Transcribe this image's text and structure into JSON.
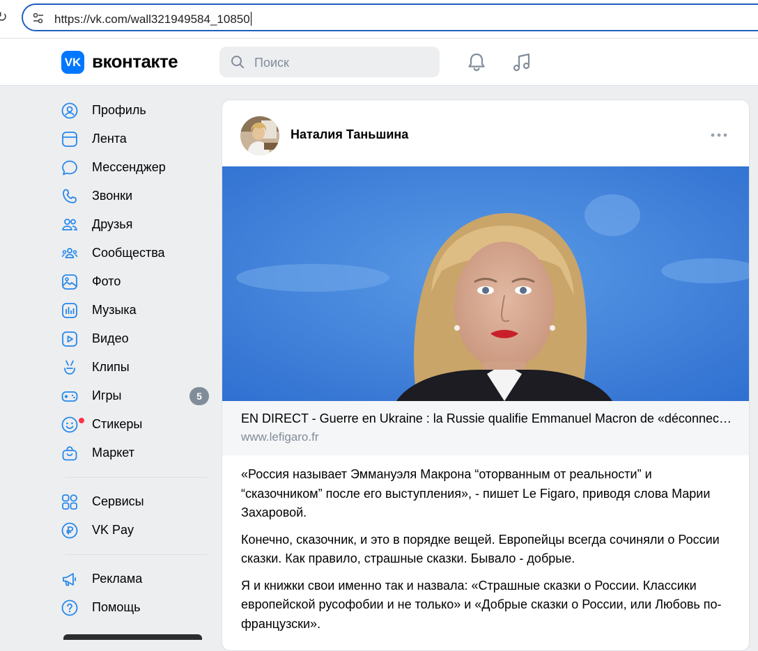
{
  "browser": {
    "url": "https://vk.com/wall321949584_10850"
  },
  "header": {
    "logo_mark": "VK",
    "logo_text": "вконтакте",
    "search_placeholder": "Поиск",
    "icons": [
      "bell-icon",
      "music-note-icon"
    ]
  },
  "sidebar": {
    "items": [
      {
        "label": "Профиль",
        "icon": "profile-icon"
      },
      {
        "label": "Лента",
        "icon": "feed-icon"
      },
      {
        "label": "Мессенджер",
        "icon": "messenger-icon"
      },
      {
        "label": "Звонки",
        "icon": "phone-icon"
      },
      {
        "label": "Друзья",
        "icon": "friends-icon"
      },
      {
        "label": "Сообщества",
        "icon": "communities-icon"
      },
      {
        "label": "Фото",
        "icon": "photo-icon"
      },
      {
        "label": "Музыка",
        "icon": "music-icon"
      },
      {
        "label": "Видео",
        "icon": "video-icon"
      },
      {
        "label": "Клипы",
        "icon": "clips-icon"
      },
      {
        "label": "Игры",
        "icon": "gamepad-icon",
        "badge": "5"
      },
      {
        "label": "Стикеры",
        "icon": "sticker-icon"
      },
      {
        "label": "Маркет",
        "icon": "market-icon"
      }
    ],
    "items2": [
      {
        "label": "Сервисы",
        "icon": "services-icon"
      },
      {
        "label": "VK Pay",
        "icon": "vkpay-icon"
      }
    ],
    "items3": [
      {
        "label": "Реклама",
        "icon": "ads-icon"
      },
      {
        "label": "Помощь",
        "icon": "help-icon"
      }
    ]
  },
  "post": {
    "author": "Наталия Таньшина",
    "link_title": "EN DIRECT - Guerre en Ukraine : la Russie qualifie Emmanuel Macron de «déconnecté de la réalité»",
    "link_domain": "www.lefigaro.fr",
    "paragraphs": [
      "«Россия называет Эммануэля Макрона “оторванным от реальности” и “сказочником” после его выступления», - пишет Le Figaro, приводя слова Марии Захаровой.",
      "Конечно, сказочник, и это в порядке вещей. Европейцы всегда сочиняли о России сказки. Как правило, страшные сказки. Бывало - добрые.",
      "Я и книжки свои именно так и назвала: «Страшные сказки о России. Классики европейской русофобии и не только» и «Добрые сказки о России, или Любовь по-французски»."
    ]
  },
  "colors": {
    "accent": "#0077ff",
    "background": "#edeef0",
    "icon": "#2688eb",
    "badge": "#818c99"
  }
}
